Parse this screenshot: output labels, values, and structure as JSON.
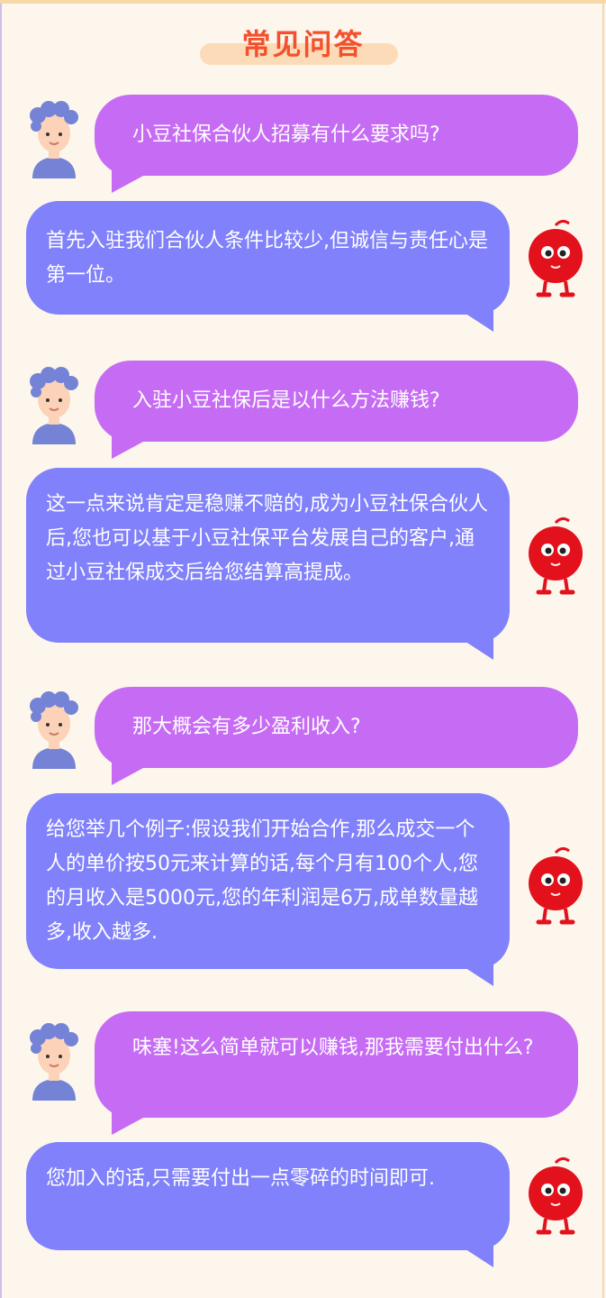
{
  "page": {
    "title": "常见问答"
  },
  "colors": {
    "background": "#fdf6ec",
    "title": "#f5502d",
    "title_pill": "#fcdcb8",
    "question_bubble": "#c66cf4",
    "answer_bubble": "#8081fb",
    "mascot_red": "#e3111c"
  },
  "icons": {
    "user": "user-avatar-icon",
    "mascot": "red-mascot-icon"
  },
  "faq": [
    {
      "question": "小豆社保合伙人招募有什么要求吗?",
      "answer": "首先入驻我们合伙人条件比较少,但诚信与责任心是第一位。"
    },
    {
      "question": "入驻小豆社保后是以什么方法赚钱?",
      "answer": "这一点来说肯定是稳赚不赔的,成为小豆社保合伙人后,您也可以基于小豆社保平台发展自己的客户,通过小豆社保成交后给您结算高提成。"
    },
    {
      "question": "那大概会有多少盈利收入?",
      "answer": "给您举几个例子:假设我们开始合作,那么成交一个人的单价按50元来计算的话,每个月有100个人,您的月收入是5000元,您的年利润是6万,成单数量越多,收入越多."
    },
    {
      "question": "味塞!这么简单就可以赚钱,那我需要付出什么?",
      "answer": "您加入的话,只需要付出一点零碎的时间即可."
    }
  ]
}
